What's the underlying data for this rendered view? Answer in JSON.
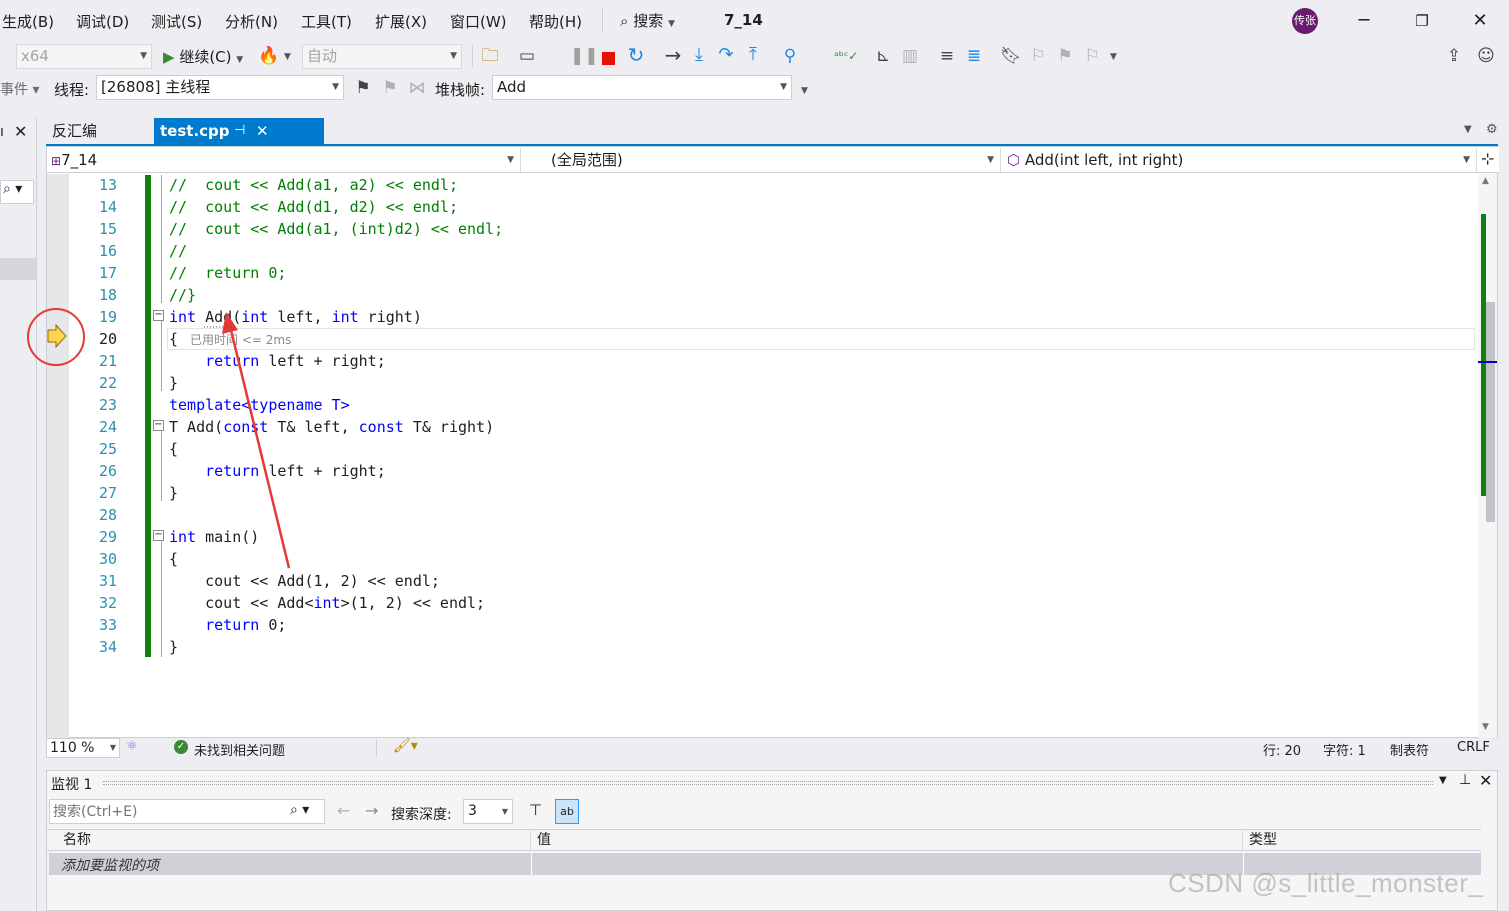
{
  "menu": {
    "items": [
      "生成(B)",
      "调试(D)",
      "测试(S)",
      "分析(N)",
      "工具(T)",
      "扩展(X)",
      "窗口(W)",
      "帮助(H)"
    ],
    "search_label": "搜索",
    "solution_name": "7_14",
    "user_avatar": "传张"
  },
  "toolbar": {
    "platform": "x64",
    "continue_label": "继续(C)",
    "auto_label": "自动"
  },
  "debug_toolbar": {
    "events_label": "事件",
    "thread_label": "线程:",
    "thread_value": "[26808] 主线程",
    "stack_label": "堆栈帧:",
    "stack_value": "Add"
  },
  "tabs": {
    "disassembly": "反汇编",
    "active_file": "test.cpp"
  },
  "navbar": {
    "project": "7_14",
    "scope": "(全局范围)",
    "member": "Add(int left, int right)"
  },
  "code": {
    "lines": [
      {
        "n": "13",
        "text": "//  cout << Add(a1, a2) << endl;"
      },
      {
        "n": "14",
        "text": "//  cout << Add(d1, d2) << endl;"
      },
      {
        "n": "15",
        "text": "//  cout << Add(a1, (int)d2) << endl;"
      },
      {
        "n": "16",
        "text": "//"
      },
      {
        "n": "17",
        "text": "//  return 0;"
      },
      {
        "n": "18",
        "text": "//}"
      },
      {
        "n": "19",
        "text": "int Add(int left, int right)"
      },
      {
        "n": "20",
        "text": "{"
      },
      {
        "n": "21",
        "text": "    return left + right;"
      },
      {
        "n": "22",
        "text": "}"
      },
      {
        "n": "23",
        "text": "template<typename T>"
      },
      {
        "n": "24",
        "text": "T Add(const T& left, const T& right)"
      },
      {
        "n": "25",
        "text": "{"
      },
      {
        "n": "26",
        "text": "    return left + right;"
      },
      {
        "n": "27",
        "text": "}"
      },
      {
        "n": "28",
        "text": ""
      },
      {
        "n": "29",
        "text": "int main()"
      },
      {
        "n": "30",
        "text": "{"
      },
      {
        "n": "31",
        "text": "    cout << Add(1, 2) << endl;"
      },
      {
        "n": "32",
        "text": "    cout << Add<int>(1, 2) << endl;"
      },
      {
        "n": "33",
        "text": "    return 0;"
      },
      {
        "n": "34",
        "text": "}"
      }
    ],
    "elapsed_hint": "已用时间 <= 2ms"
  },
  "editor_status": {
    "zoom": "110 %",
    "issues": "未找到相关问题",
    "line": "行: 20",
    "char": "字符: 1",
    "indent": "制表符",
    "eol": "CRLF"
  },
  "watch": {
    "title": "监视 1",
    "search_placeholder": "搜索(Ctrl+E)",
    "depth_label": "搜索深度:",
    "depth_value": "3",
    "col_name": "名称",
    "col_value": "值",
    "col_type": "类型",
    "add_item": "添加要监视的项"
  },
  "watermark": "CSDN @s_little_monster_",
  "colors": {
    "keyword": "#0000ff",
    "comment": "#008000",
    "line_number": "#2b91af",
    "tab_active": "#007acc",
    "annotation": "#e53935"
  }
}
